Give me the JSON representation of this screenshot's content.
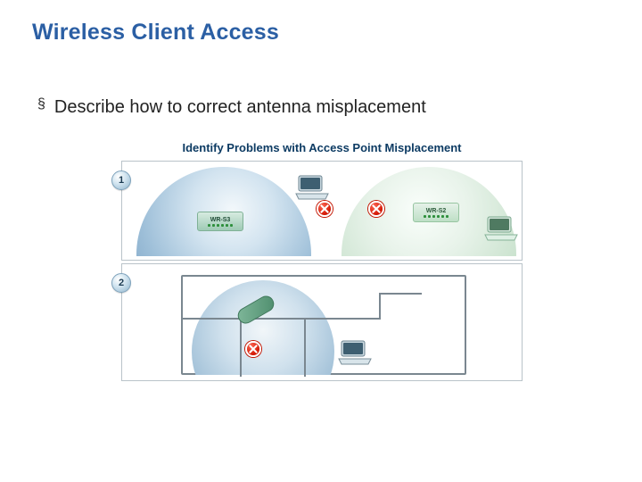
{
  "title": "Wireless Client Access",
  "bullet": {
    "marker": "§",
    "text": "Describe how to correct antenna misplacement"
  },
  "diagram": {
    "heading": "Identify Problems with Access Point Misplacement",
    "panel1": {
      "num": "1",
      "ap1_label": "WR-S3",
      "ap2_label": "WR-S2"
    },
    "panel2": {
      "num": "2"
    }
  }
}
